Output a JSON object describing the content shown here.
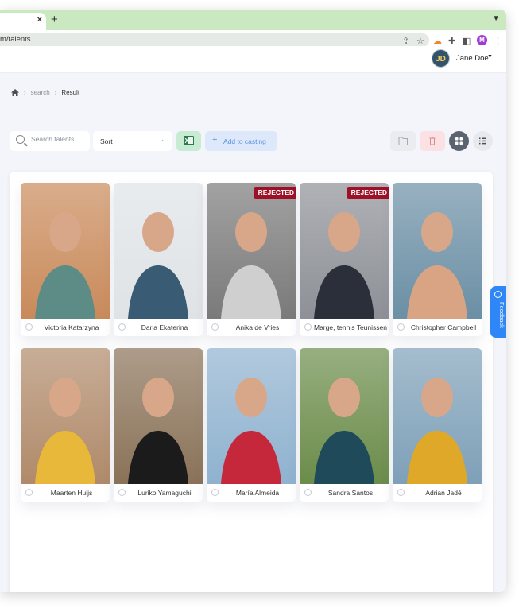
{
  "browser": {
    "tab_close": "×",
    "new_tab": "+",
    "url": "m/talents",
    "profile_initial": "M"
  },
  "header": {
    "user_initials": "JD",
    "user_name": "Jane Doe"
  },
  "breadcrumb": {
    "items": [
      "search",
      "Result"
    ]
  },
  "toolbar": {
    "search_placeholder": "Search talents...",
    "sort_label": "Sort",
    "add_to_casting": "Add to casting"
  },
  "talents": [
    {
      "name": "Victoria Katarzyna",
      "status": "",
      "bg": "#c98a5a",
      "fg": "#5d8c86"
    },
    {
      "name": "Daria Ekaterina",
      "status": "",
      "bg": "#dfe3e6",
      "fg": "#3a5b74"
    },
    {
      "name": "Anika de Vries",
      "status": "REJECTED",
      "bg": "#7a7a7a",
      "fg": "#cfcfcf"
    },
    {
      "name": "Marge, tennis Teunissen",
      "status": "REJECTED",
      "bg": "#8d9096",
      "fg": "#2a2f3a"
    },
    {
      "name": "Christopher Campbell",
      "status": "",
      "bg": "#6b8fa5",
      "fg": "#d9a484"
    },
    {
      "name": "Maarten Huijs",
      "status": "",
      "bg": "#b08a6a",
      "fg": "#e8b83a"
    },
    {
      "name": "Luriko Yamaguchi",
      "status": "",
      "bg": "#8a7258",
      "fg": "#1b1b1b"
    },
    {
      "name": "María Almeida",
      "status": "",
      "bg": "#8fb2cf",
      "fg": "#c4283a"
    },
    {
      "name": "Sandra Santos",
      "status": "",
      "bg": "#6b8c4a",
      "fg": "#1f4a5a"
    },
    {
      "name": "Adrian Jadé",
      "status": "",
      "bg": "#7ea0b8",
      "fg": "#e0a829"
    }
  ],
  "feedback_label": "Feedback",
  "colors": {
    "accent": "#2f86f6",
    "rejected": "#9e1026",
    "tabbar": "#cbe9c1"
  }
}
